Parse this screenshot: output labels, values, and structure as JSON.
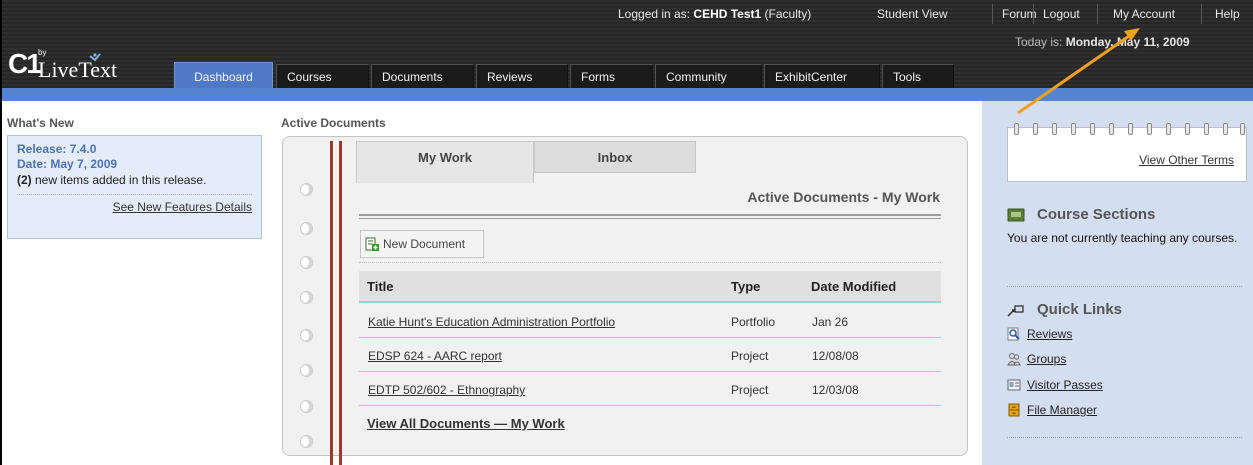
{
  "topbar": {
    "logged_in_prefix": "Logged in as: ",
    "user_name": "CEHD Test1",
    "user_role": "(Faculty)",
    "student_view": "Student View",
    "forum": "Forum",
    "logout": "Logout",
    "my_account": "My Account",
    "help": "Help",
    "today_prefix": "Today is: ",
    "today_date": "Monday, May 11, 2009"
  },
  "logo": {
    "c1": "C1",
    "by": "by",
    "name": "LiveText"
  },
  "nav": {
    "tabs": [
      {
        "label": "Dashboard",
        "active": true
      },
      {
        "label": "Courses"
      },
      {
        "label": "Documents"
      },
      {
        "label": "Reviews"
      },
      {
        "label": "Forms"
      },
      {
        "label": "Community"
      },
      {
        "label": "ExhibitCenter"
      },
      {
        "label": "Tools"
      }
    ]
  },
  "whats_new": {
    "title": "What's New",
    "release": "Release: 7.4.0",
    "date": "Date: May 7, 2009",
    "count": "(2)",
    "items_text": " new items added in this release.",
    "link": "See New Features Details"
  },
  "active_documents": {
    "title": "Active Documents",
    "tabs": {
      "my_work": "My Work",
      "inbox": "Inbox"
    },
    "heading": "Active Documents - My Work",
    "new_document": "New Document",
    "columns": {
      "title": "Title",
      "type": "Type",
      "date": "Date Modified"
    },
    "rows": [
      {
        "title": "Katie Hunt's Education Administration Portfolio",
        "type": "Portfolio",
        "date": "Jan 26"
      },
      {
        "title": "EDSP 624 - AARC report",
        "type": "Project",
        "date": "12/08/08"
      },
      {
        "title": "EDTP 502/602 - Ethnography",
        "type": "Project",
        "date": "12/03/08"
      }
    ],
    "view_all": "View All Documents — My Work"
  },
  "right": {
    "view_terms": "View Other Terms",
    "course_sections_title": "Course Sections",
    "course_sections_text": "You are not currently teaching any courses.",
    "quick_links_title": "Quick Links",
    "quick_links": [
      {
        "label": "Reviews",
        "icon": "magnifier-icon"
      },
      {
        "label": "Groups",
        "icon": "people-icon"
      },
      {
        "label": "Visitor Passes",
        "icon": "id-card-icon"
      },
      {
        "label": "File Manager",
        "icon": "file-cabinet-icon"
      }
    ]
  },
  "colors": {
    "header_bg": "#2b2b2b",
    "accent_blue": "#4f79c4",
    "right_panel": "#d3dff1",
    "spine": "#9c3a2e",
    "annotation_arrow": "#f0a020"
  }
}
